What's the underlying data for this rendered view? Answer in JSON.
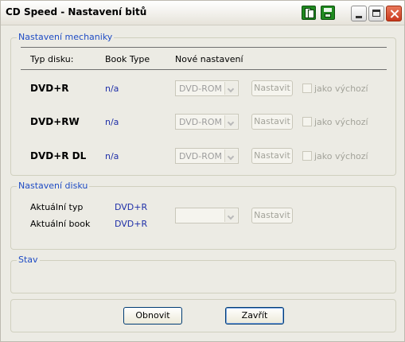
{
  "window": {
    "title": "CD Speed - Nastavení bitů"
  },
  "titlebar_icons": [
    "copy-icon",
    "save-icon"
  ],
  "drive_settings": {
    "legend": "Nastavení mechaniky",
    "headers": {
      "disc_type": "Typ disku:",
      "book_type": "Book Type",
      "new_setting": "Nové nastavení"
    },
    "rows": [
      {
        "disc": "DVD+R",
        "book": "n/a",
        "combo_value": "DVD-ROM",
        "button": "Nastavit",
        "checkbox_label": "jako výchozí"
      },
      {
        "disc": "DVD+RW",
        "book": "n/a",
        "combo_value": "DVD-ROM",
        "button": "Nastavit",
        "checkbox_label": "jako výchozí"
      },
      {
        "disc": "DVD+R DL",
        "book": "n/a",
        "combo_value": "DVD-ROM",
        "button": "Nastavit",
        "checkbox_label": "jako výchozí"
      }
    ]
  },
  "disc_settings": {
    "legend": "Nastavení disku",
    "current_type_label": "Aktuální typ",
    "current_type_value": "DVD+R",
    "current_book_label": "Aktuální book",
    "current_book_value": "DVD+R",
    "button": "Nastavit"
  },
  "status": {
    "legend": "Stav"
  },
  "footer": {
    "refresh": "Obnovit",
    "close": "Zavřít"
  }
}
